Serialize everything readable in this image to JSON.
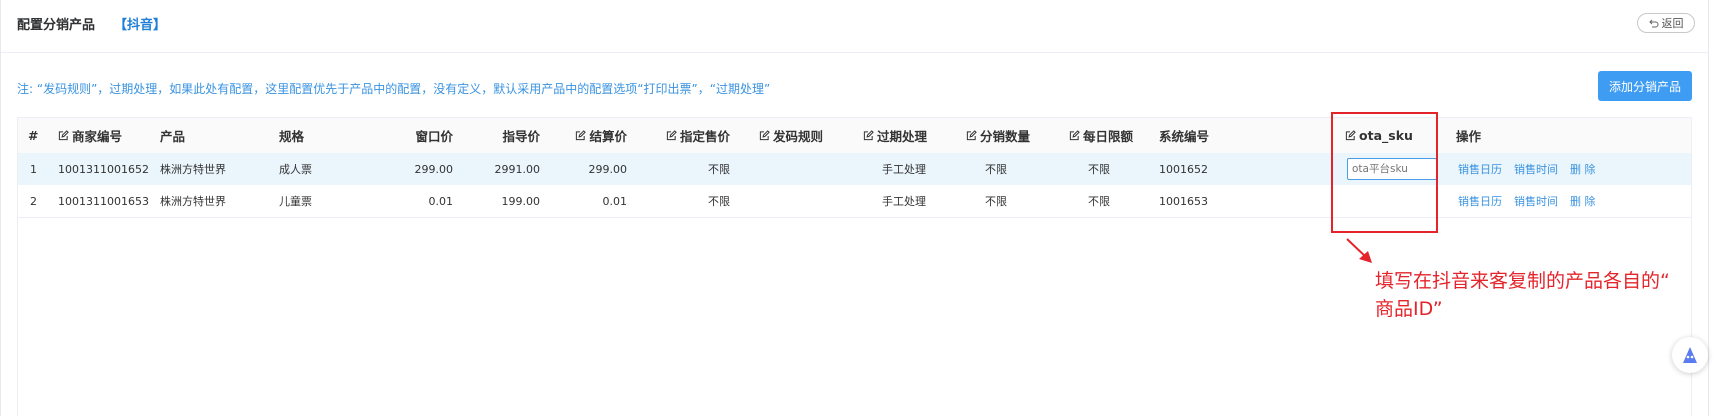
{
  "header": {
    "title": "配置分销产品",
    "platform": "【抖音】",
    "back_label": "返回"
  },
  "note": "注: “发码规则”，过期处理，如果此处有配置，这里配置优先于产品中的配置，没有定义，默认采用产品中的配置选项“打印出票”，“过期处理”",
  "add_button": "添加分销产品",
  "table": {
    "columns": {
      "index": "#",
      "merchant_code": "商家编号",
      "product": "产品",
      "spec": "规格",
      "window_price": "窗口价",
      "guide_price": "指导价",
      "settle_price": "结算价",
      "sale_price": "指定售价",
      "code_rule": "发码规则",
      "expire": "过期处理",
      "dist_qty": "分销数量",
      "daily_limit": "每日限额",
      "sys_code": "系统编号",
      "ota_sku": "ota_sku",
      "actions": "操作"
    },
    "rows": [
      {
        "index": "1",
        "merchant_code": "1001311001652",
        "product": "株洲方特世界",
        "spec": "成人票",
        "window_price": "299.00",
        "guide_price": "2991.00",
        "settle_price": "299.00",
        "sale_price": "不限",
        "code_rule": "",
        "expire": "手工处理",
        "dist_qty": "不限",
        "daily_limit": "不限",
        "sys_code": "1001652"
      },
      {
        "index": "2",
        "merchant_code": "1001311001653",
        "product": "株洲方特世界",
        "spec": "儿童票",
        "window_price": "0.01",
        "guide_price": "199.00",
        "settle_price": "0.01",
        "sale_price": "不限",
        "code_rule": "",
        "expire": "手工处理",
        "dist_qty": "不限",
        "daily_limit": "不限",
        "sys_code": "1001653"
      }
    ],
    "sku_placeholder": "ota平台sku",
    "actions": {
      "calendar": "销售日历",
      "time": "销售时间",
      "delete": "删 除"
    }
  },
  "annotation": {
    "line1": "填写在抖音来客复制的产品各自的“",
    "line2": "商品ID”"
  },
  "colors": {
    "accent": "#3e9cf3",
    "link": "#3a93e0",
    "annotation_red": "#e4242b",
    "selected_row": "#eaf5fc"
  },
  "icons": {
    "back": "undo-icon",
    "edit": "edit-icon",
    "assistant": "assistant-icon"
  }
}
